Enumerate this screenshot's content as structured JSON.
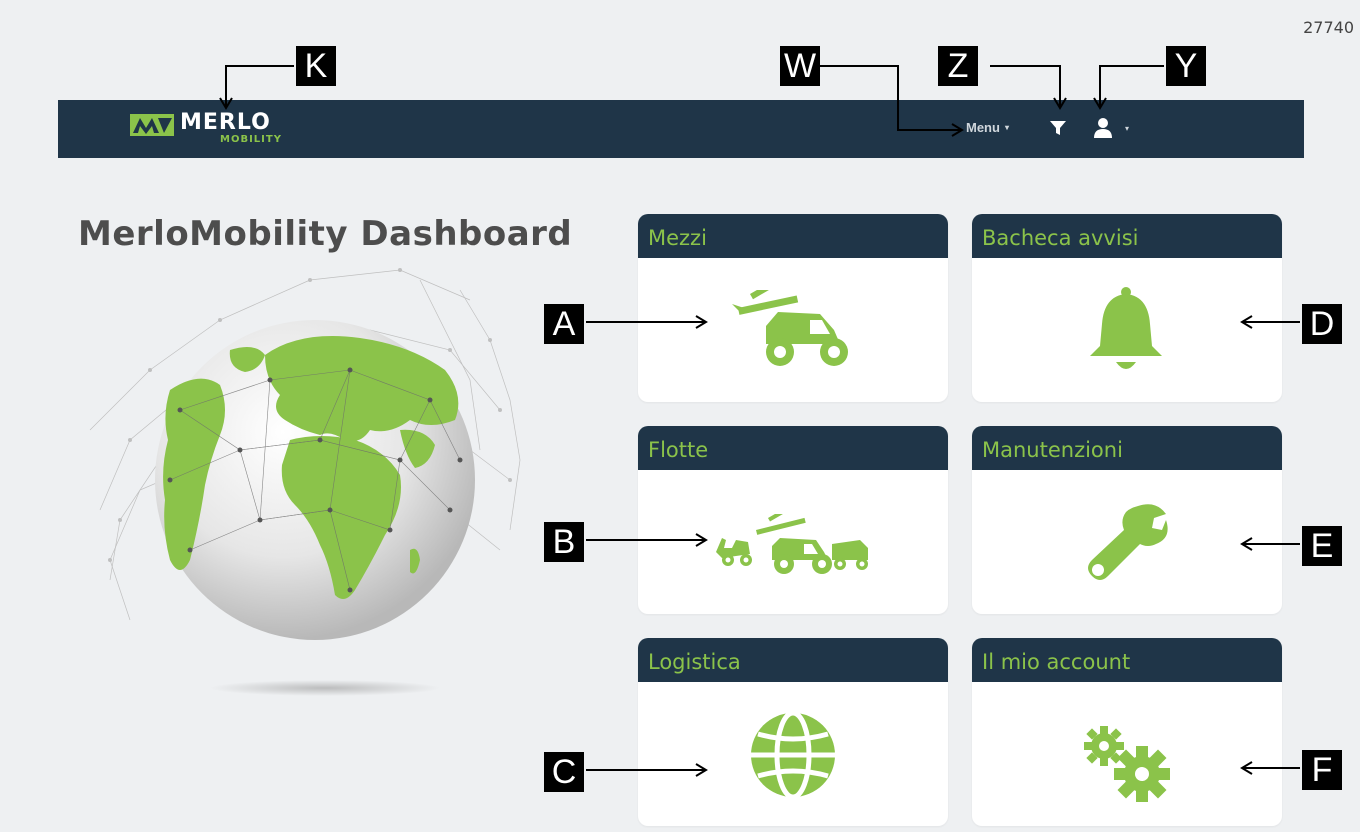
{
  "doc_id": "27740",
  "header": {
    "logo_word": "MERLO",
    "logo_sub": "MOBILITY",
    "menu_label": "Menu"
  },
  "icons": {
    "filter": "filter-icon",
    "user": "user-icon",
    "logo": "merlo-logo-icon"
  },
  "page_title": "MerloMobility Dashboard",
  "tiles": [
    {
      "label": "Mezzi",
      "icon": "telehandler-icon"
    },
    {
      "label": "Bacheca avvisi",
      "icon": "bell-icon"
    },
    {
      "label": "Flotte",
      "icon": "fleet-vehicles-icon"
    },
    {
      "label": "Manutenzioni",
      "icon": "wrench-icon"
    },
    {
      "label": "Logistica",
      "icon": "globe-icon"
    },
    {
      "label": "Il mio account",
      "icon": "gears-icon"
    }
  ],
  "callouts": {
    "K": "K",
    "W": "W",
    "Z": "Z",
    "Y": "Y",
    "A": "A",
    "B": "B",
    "C": "C",
    "D": "D",
    "E": "E",
    "F": "F"
  },
  "colors": {
    "navbar": "#1f3548",
    "accent_green": "#8bc34a",
    "background": "#eef0f2"
  }
}
